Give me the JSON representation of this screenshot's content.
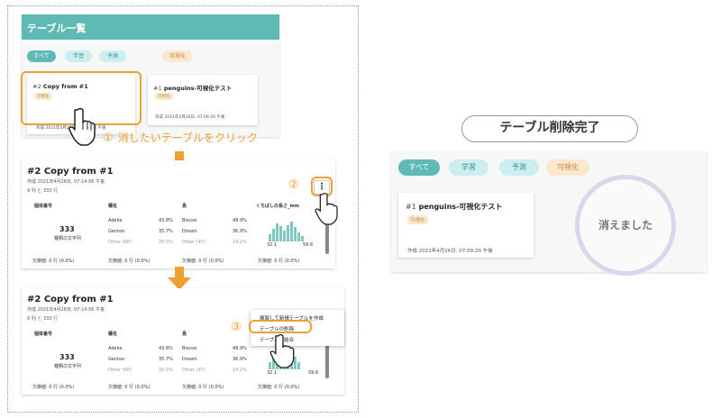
{
  "panel1": {
    "title": "テーブル一覧",
    "filters": [
      "すべて",
      "学習",
      "予測",
      "可視化"
    ],
    "card1": {
      "num": "#2",
      "title": "Copy from #1",
      "tag": "可視化",
      "date": "作成 2021年4月26日, 07:14:56 午後"
    },
    "card2": {
      "num": "#1",
      "title": "penguins-可視化テスト",
      "tag": "可視化",
      "date": "作成 2021年4月26日, 07:09:20 午後"
    }
  },
  "step1": {
    "marker": "①",
    "text": "消したいテーブルをクリック"
  },
  "step2": {
    "marker": "②"
  },
  "step3": {
    "marker": "③"
  },
  "detail": {
    "title": "#2  Copy from #1",
    "created": "作成 2021年4月26日, 07:14:56 午後",
    "size": "9 列 と 333 行",
    "columns": [
      "個体番号",
      "種名",
      "島",
      "くちばしの長さ_mm"
    ],
    "col1_count": "333",
    "col1_label": "種類の文字列",
    "species": [
      {
        "name": "Adelie",
        "pct": "43.8%"
      },
      {
        "name": "Gentoo",
        "pct": "35.7%"
      },
      {
        "name": "Other (68)",
        "pct": "20.5%"
      }
    ],
    "islands": [
      {
        "name": "Biscoe",
        "pct": "48.9%"
      },
      {
        "name": "Dream",
        "pct": "36.9%"
      },
      {
        "name": "Other (47)",
        "pct": "14.2%"
      }
    ],
    "hist_min": "32.1",
    "hist_max": "59.6",
    "missing": "欠損値: 0 行 (0.0%)",
    "kebab": "⋮"
  },
  "menu": {
    "items": [
      "複製して新規テーブルを作成",
      "テーブルの削除",
      "テーブルの結合"
    ]
  },
  "result": {
    "done_label": "テーブル削除完了",
    "filters": [
      "すべて",
      "学習",
      "予測",
      "可視化"
    ],
    "card": {
      "num": "#1",
      "title": "penguins-可視化テスト",
      "tag": "可視化",
      "date": "作成 2021年4月26日, 07:09:20 午後"
    },
    "gone": "消えました"
  },
  "colors": {
    "teal": "#5fb9b5",
    "orange": "#f0a030",
    "cyan_chip": "#cdeeee",
    "orange_chip": "#fbe8cf",
    "hist": "#7fc7c3"
  }
}
